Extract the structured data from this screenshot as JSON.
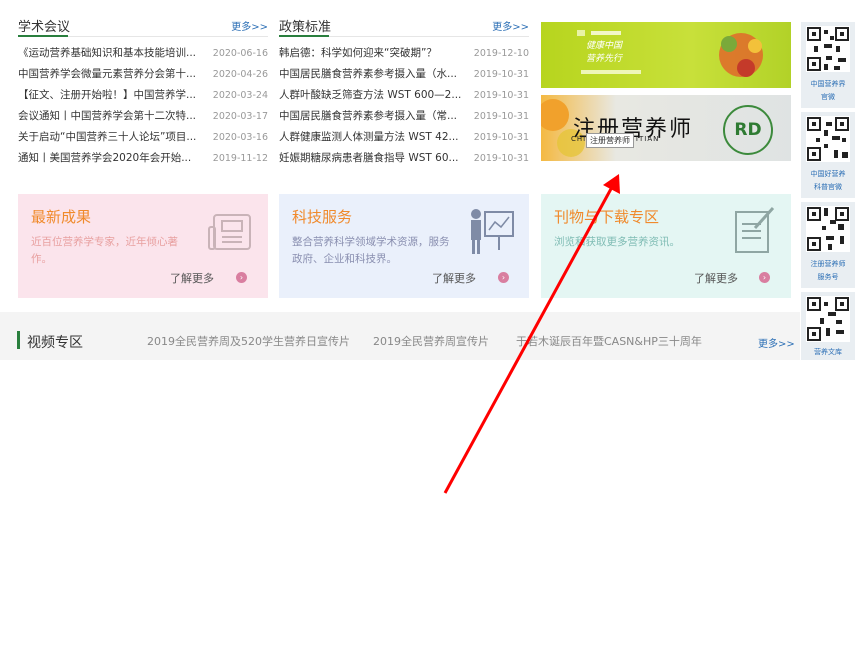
{
  "academic": {
    "title": "学术会议",
    "more": "更多>>",
    "items": [
      {
        "title": "《运动营养基础知识和基本技能培训...",
        "date": "2020-06-16"
      },
      {
        "title": "中国营养学会微量元素营养分会第十...",
        "date": "2020-04-26"
      },
      {
        "title": "【征文、注册开始啦！】中国营养学...",
        "date": "2020-03-24"
      },
      {
        "title": "会议通知丨中国营养学会第十二次特...",
        "date": "2020-03-17"
      },
      {
        "title": "关于启动“中国营养三十人论坛”项目...",
        "date": "2020-03-16"
      },
      {
        "title": "通知丨美国营养学会2020年会开始...",
        "date": "2019-11-12"
      }
    ]
  },
  "policy": {
    "title": "政策标准",
    "more": "更多>>",
    "items": [
      {
        "title": "韩启德：科学如何迎来“突破期”？",
        "date": "2019-12-10"
      },
      {
        "title": "中国居民膳食营养素参考摄入量（水...",
        "date": "2019-10-31"
      },
      {
        "title": "人群叶酸缺乏筛查方法 WST 600—2...",
        "date": "2019-10-31"
      },
      {
        "title": "中国居民膳食营养素参考摄入量（常...",
        "date": "2019-10-31"
      },
      {
        "title": "人群健康监测人体测量方法 WST 42...",
        "date": "2019-10-31"
      },
      {
        "title": "妊娠期糖尿病患者膳食指导 WST 60...",
        "date": "2019-10-31"
      }
    ]
  },
  "banners": {
    "banner1": {
      "line1": "健康中国",
      "line2": "营养先行"
    },
    "banner2": {
      "title": "注册营养师",
      "subtitle": "CHI          ERED DIETITIAN",
      "logo": "RD",
      "tooltip": "注册营养师"
    }
  },
  "cards": [
    {
      "title": "最新成果",
      "desc": "近百位营养学专家，近年倾心著作。",
      "more": "了解更多",
      "color": "#f08a2c",
      "bg": "#fbe4ec",
      "arrow_color": "#d97ea0"
    },
    {
      "title": "科技服务",
      "desc": "整合营养科学领域学术资源，服务政府、企业和科技界。",
      "more": "了解更多",
      "color": "#f08a2c",
      "bg": "#eaf0fb",
      "arrow_color": "#d97ea0"
    },
    {
      "title": "刊物与下载专区",
      "desc": "浏览和获取更多营养资讯。",
      "more": "了解更多",
      "color": "#f08a2c",
      "bg": "#e4f6f3",
      "arrow_color": "#d97ea0"
    }
  ],
  "video": {
    "title": "视频专区",
    "links": [
      "2019全民营养周及520学生营养日宣传片",
      "2019全民营养周宣传片",
      "于若木诞辰百年暨CASN&HP三十周年"
    ],
    "more": "更多>>"
  },
  "qr": [
    {
      "caption1": "中国营养界",
      "caption2": "官微"
    },
    {
      "caption1": "中国好营养",
      "caption2": "科普官微"
    },
    {
      "caption1": "注册营养师",
      "caption2": "服务号"
    },
    {
      "caption1": "营养文库",
      "caption2": ""
    }
  ],
  "colors": {
    "accent_green": "#2a7f3e",
    "link_blue": "#2c6fb5",
    "annotation_red": "#ff0000"
  }
}
